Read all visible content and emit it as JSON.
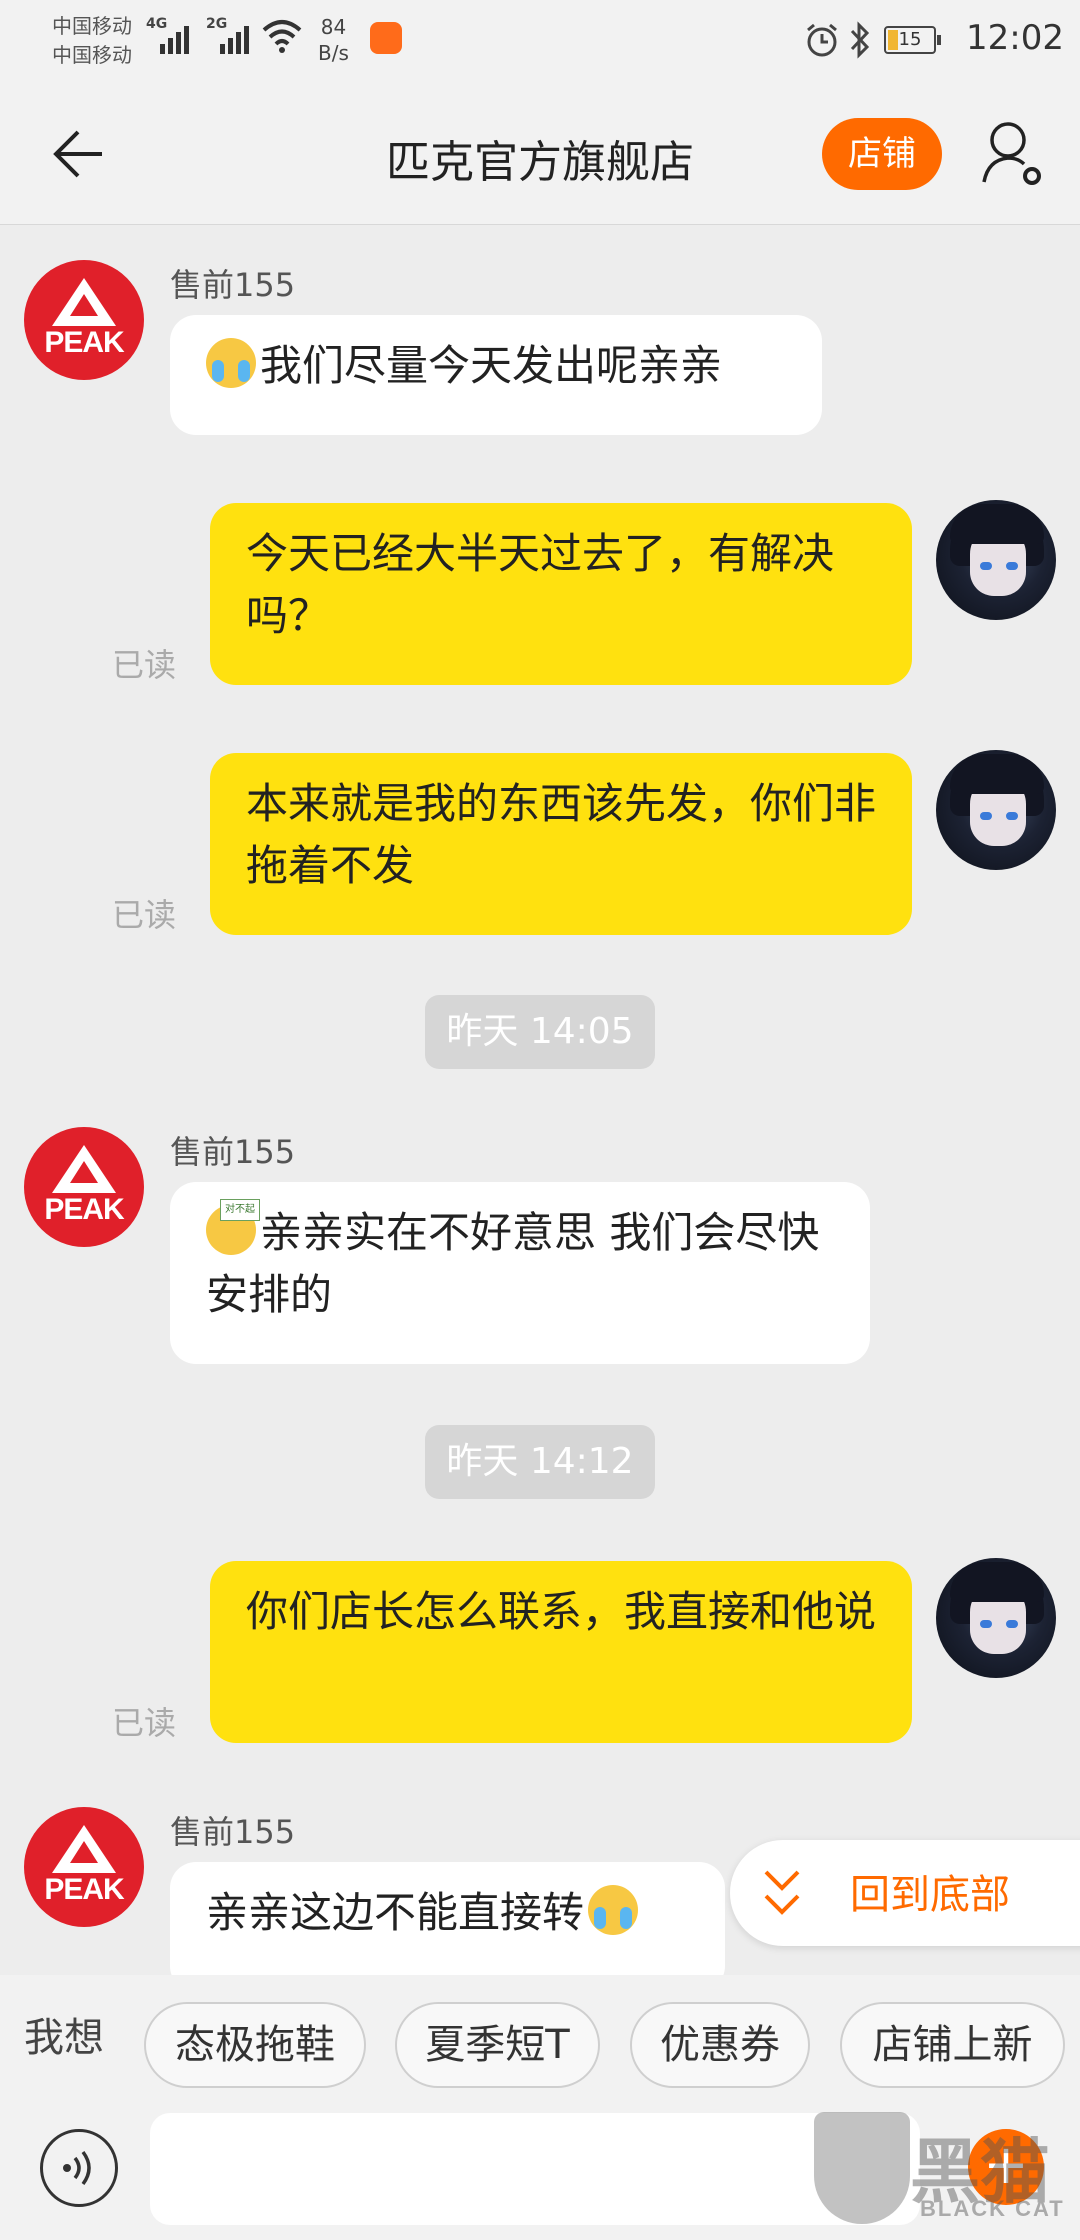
{
  "status_bar": {
    "carrier_1": "中国移动",
    "carrier_2": "中国移动",
    "net_1": "4G",
    "net_2": "2G",
    "speed_value": "84",
    "speed_unit": "B/s",
    "battery": "15",
    "time": "12:02"
  },
  "header": {
    "title": "匹克官方旗舰店",
    "shop_button": "店铺"
  },
  "messages": {
    "m1": {
      "sender": "售前155",
      "text": "我们尽量今天发出呢亲亲"
    },
    "m2": {
      "text": "今天已经大半天过去了，有解决吗？",
      "status": "已读"
    },
    "m3": {
      "text": "本来就是我的东西该先发，你们非拖着不发",
      "status": "已读"
    },
    "t1": "昨天  14:05",
    "m4": {
      "sender": "售前155",
      "text": "亲亲实在不好意思 我们会尽快安排的",
      "emoji_sign": "对不起"
    },
    "t2": "昨天  14:12",
    "m5": {
      "text": "你们店长怎么联系，我直接和他说",
      "status": "已读"
    },
    "m6": {
      "sender": "售前155",
      "text": "亲亲这边不能直接转"
    }
  },
  "avatar_logo": "PEAK",
  "jump_to_bottom": "回到底部",
  "quick_bar": {
    "label": "我想",
    "chips": [
      "态极拖鞋",
      "夏季短T",
      "优惠券",
      "店铺上新"
    ]
  },
  "input": {
    "placeholder": ""
  },
  "watermark": {
    "brand": "黑猫",
    "sub": "BLACK CAT"
  },
  "colors": {
    "accent": "#ff6a00",
    "my_bubble": "#ffe10f",
    "their_bubble": "#ffffff",
    "background": "#ededed"
  }
}
